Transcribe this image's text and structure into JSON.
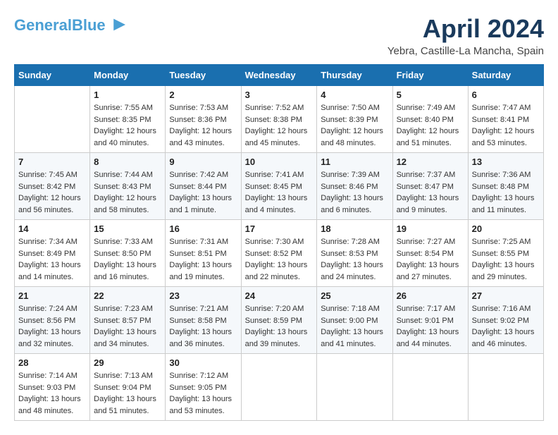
{
  "header": {
    "logo_general": "General",
    "logo_blue": "Blue",
    "month_title": "April 2024",
    "location": "Yebra, Castille-La Mancha, Spain"
  },
  "days_of_week": [
    "Sunday",
    "Monday",
    "Tuesday",
    "Wednesday",
    "Thursday",
    "Friday",
    "Saturday"
  ],
  "weeks": [
    [
      {
        "day": "",
        "sunrise": "",
        "sunset": "",
        "daylight": ""
      },
      {
        "day": "1",
        "sunrise": "Sunrise: 7:55 AM",
        "sunset": "Sunset: 8:35 PM",
        "daylight": "Daylight: 12 hours and 40 minutes."
      },
      {
        "day": "2",
        "sunrise": "Sunrise: 7:53 AM",
        "sunset": "Sunset: 8:36 PM",
        "daylight": "Daylight: 12 hours and 43 minutes."
      },
      {
        "day": "3",
        "sunrise": "Sunrise: 7:52 AM",
        "sunset": "Sunset: 8:38 PM",
        "daylight": "Daylight: 12 hours and 45 minutes."
      },
      {
        "day": "4",
        "sunrise": "Sunrise: 7:50 AM",
        "sunset": "Sunset: 8:39 PM",
        "daylight": "Daylight: 12 hours and 48 minutes."
      },
      {
        "day": "5",
        "sunrise": "Sunrise: 7:49 AM",
        "sunset": "Sunset: 8:40 PM",
        "daylight": "Daylight: 12 hours and 51 minutes."
      },
      {
        "day": "6",
        "sunrise": "Sunrise: 7:47 AM",
        "sunset": "Sunset: 8:41 PM",
        "daylight": "Daylight: 12 hours and 53 minutes."
      }
    ],
    [
      {
        "day": "7",
        "sunrise": "Sunrise: 7:45 AM",
        "sunset": "Sunset: 8:42 PM",
        "daylight": "Daylight: 12 hours and 56 minutes."
      },
      {
        "day": "8",
        "sunrise": "Sunrise: 7:44 AM",
        "sunset": "Sunset: 8:43 PM",
        "daylight": "Daylight: 12 hours and 58 minutes."
      },
      {
        "day": "9",
        "sunrise": "Sunrise: 7:42 AM",
        "sunset": "Sunset: 8:44 PM",
        "daylight": "Daylight: 13 hours and 1 minute."
      },
      {
        "day": "10",
        "sunrise": "Sunrise: 7:41 AM",
        "sunset": "Sunset: 8:45 PM",
        "daylight": "Daylight: 13 hours and 4 minutes."
      },
      {
        "day": "11",
        "sunrise": "Sunrise: 7:39 AM",
        "sunset": "Sunset: 8:46 PM",
        "daylight": "Daylight: 13 hours and 6 minutes."
      },
      {
        "day": "12",
        "sunrise": "Sunrise: 7:37 AM",
        "sunset": "Sunset: 8:47 PM",
        "daylight": "Daylight: 13 hours and 9 minutes."
      },
      {
        "day": "13",
        "sunrise": "Sunrise: 7:36 AM",
        "sunset": "Sunset: 8:48 PM",
        "daylight": "Daylight: 13 hours and 11 minutes."
      }
    ],
    [
      {
        "day": "14",
        "sunrise": "Sunrise: 7:34 AM",
        "sunset": "Sunset: 8:49 PM",
        "daylight": "Daylight: 13 hours and 14 minutes."
      },
      {
        "day": "15",
        "sunrise": "Sunrise: 7:33 AM",
        "sunset": "Sunset: 8:50 PM",
        "daylight": "Daylight: 13 hours and 16 minutes."
      },
      {
        "day": "16",
        "sunrise": "Sunrise: 7:31 AM",
        "sunset": "Sunset: 8:51 PM",
        "daylight": "Daylight: 13 hours and 19 minutes."
      },
      {
        "day": "17",
        "sunrise": "Sunrise: 7:30 AM",
        "sunset": "Sunset: 8:52 PM",
        "daylight": "Daylight: 13 hours and 22 minutes."
      },
      {
        "day": "18",
        "sunrise": "Sunrise: 7:28 AM",
        "sunset": "Sunset: 8:53 PM",
        "daylight": "Daylight: 13 hours and 24 minutes."
      },
      {
        "day": "19",
        "sunrise": "Sunrise: 7:27 AM",
        "sunset": "Sunset: 8:54 PM",
        "daylight": "Daylight: 13 hours and 27 minutes."
      },
      {
        "day": "20",
        "sunrise": "Sunrise: 7:25 AM",
        "sunset": "Sunset: 8:55 PM",
        "daylight": "Daylight: 13 hours and 29 minutes."
      }
    ],
    [
      {
        "day": "21",
        "sunrise": "Sunrise: 7:24 AM",
        "sunset": "Sunset: 8:56 PM",
        "daylight": "Daylight: 13 hours and 32 minutes."
      },
      {
        "day": "22",
        "sunrise": "Sunrise: 7:23 AM",
        "sunset": "Sunset: 8:57 PM",
        "daylight": "Daylight: 13 hours and 34 minutes."
      },
      {
        "day": "23",
        "sunrise": "Sunrise: 7:21 AM",
        "sunset": "Sunset: 8:58 PM",
        "daylight": "Daylight: 13 hours and 36 minutes."
      },
      {
        "day": "24",
        "sunrise": "Sunrise: 7:20 AM",
        "sunset": "Sunset: 8:59 PM",
        "daylight": "Daylight: 13 hours and 39 minutes."
      },
      {
        "day": "25",
        "sunrise": "Sunrise: 7:18 AM",
        "sunset": "Sunset: 9:00 PM",
        "daylight": "Daylight: 13 hours and 41 minutes."
      },
      {
        "day": "26",
        "sunrise": "Sunrise: 7:17 AM",
        "sunset": "Sunset: 9:01 PM",
        "daylight": "Daylight: 13 hours and 44 minutes."
      },
      {
        "day": "27",
        "sunrise": "Sunrise: 7:16 AM",
        "sunset": "Sunset: 9:02 PM",
        "daylight": "Daylight: 13 hours and 46 minutes."
      }
    ],
    [
      {
        "day": "28",
        "sunrise": "Sunrise: 7:14 AM",
        "sunset": "Sunset: 9:03 PM",
        "daylight": "Daylight: 13 hours and 48 minutes."
      },
      {
        "day": "29",
        "sunrise": "Sunrise: 7:13 AM",
        "sunset": "Sunset: 9:04 PM",
        "daylight": "Daylight: 13 hours and 51 minutes."
      },
      {
        "day": "30",
        "sunrise": "Sunrise: 7:12 AM",
        "sunset": "Sunset: 9:05 PM",
        "daylight": "Daylight: 13 hours and 53 minutes."
      },
      {
        "day": "",
        "sunrise": "",
        "sunset": "",
        "daylight": ""
      },
      {
        "day": "",
        "sunrise": "",
        "sunset": "",
        "daylight": ""
      },
      {
        "day": "",
        "sunrise": "",
        "sunset": "",
        "daylight": ""
      },
      {
        "day": "",
        "sunrise": "",
        "sunset": "",
        "daylight": ""
      }
    ]
  ]
}
